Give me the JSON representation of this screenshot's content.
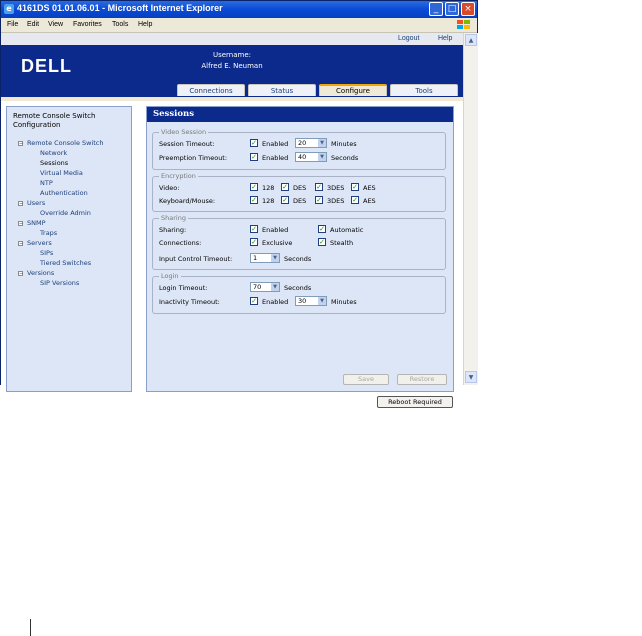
{
  "window": {
    "title": "4161DS 01.01.06.01 - Microsoft Internet Explorer"
  },
  "menu": [
    "File",
    "Edit",
    "View",
    "Favorites",
    "Tools",
    "Help"
  ],
  "toplinks": {
    "logout": "Logout",
    "help": "Help"
  },
  "header": {
    "logo": "DELL",
    "username_label": "Username:",
    "username": "Alfred E. Neuman"
  },
  "tabs": [
    {
      "label": "Connections",
      "active": false
    },
    {
      "label": "Status",
      "active": false
    },
    {
      "label": "Configure",
      "active": true
    },
    {
      "label": "Tools",
      "active": false
    }
  ],
  "sidebar": {
    "title": "Remote Console Switch Configuration",
    "items": [
      {
        "label": "Remote Console Switch",
        "level": 0
      },
      {
        "label": "Network",
        "level": 1
      },
      {
        "label": "Sessions",
        "level": 1
      },
      {
        "label": "Virtual Media",
        "level": 1
      },
      {
        "label": "NTP",
        "level": 1
      },
      {
        "label": "Authentication",
        "level": 1
      },
      {
        "label": "Users",
        "level": 0
      },
      {
        "label": "Override Admin",
        "level": 1
      },
      {
        "label": "SNMP",
        "level": 0
      },
      {
        "label": "Traps",
        "level": 1
      },
      {
        "label": "Servers",
        "level": 0
      },
      {
        "label": "SIPs",
        "level": 1
      },
      {
        "label": "Tiered Switches",
        "level": 1
      },
      {
        "label": "Versions",
        "level": 0
      },
      {
        "label": "SIP Versions",
        "level": 1
      }
    ]
  },
  "sessions": {
    "title": "Sessions",
    "video_session": {
      "title": "Video Session",
      "session_timeout_label": "Session Timeout:",
      "session_enabled_label": "Enabled",
      "session_enabled": true,
      "session_timeout_value": "20",
      "session_unit": "Minutes",
      "preemption_timeout_label": "Preemption Timeout:",
      "preemption_enabled_label": "Enabled",
      "preemption_enabled": true,
      "preemption_timeout_value": "40",
      "preemption_unit": "Seconds"
    },
    "encryption": {
      "title": "Encryption",
      "video_label": "Video:",
      "keyboard_label": "Keyboard/Mouse:",
      "options": [
        "128",
        "DES",
        "3DES",
        "AES"
      ]
    },
    "sharing": {
      "title": "Sharing",
      "sharing_label": "Sharing:",
      "enabled_label": "Enabled",
      "automatic_label": "Automatic",
      "connections_label": "Connections:",
      "exclusive_label": "Exclusive",
      "stealth_label": "Stealth",
      "input_control_label": "Input Control Timeout:",
      "input_control_value": "1",
      "input_control_unit": "Seconds"
    },
    "login": {
      "title": "Login",
      "login_timeout_label": "Login Timeout:",
      "login_timeout_value": "70",
      "login_timeout_unit": "Seconds",
      "inactivity_label": "Inactivity Timeout:",
      "inactivity_enabled_label": "Enabled",
      "inactivity_enabled": true,
      "inactivity_value": "30",
      "inactivity_unit": "Minutes"
    },
    "save_label": "Save",
    "restore_label": "Restore"
  },
  "reboot_label": "Reboot Required"
}
